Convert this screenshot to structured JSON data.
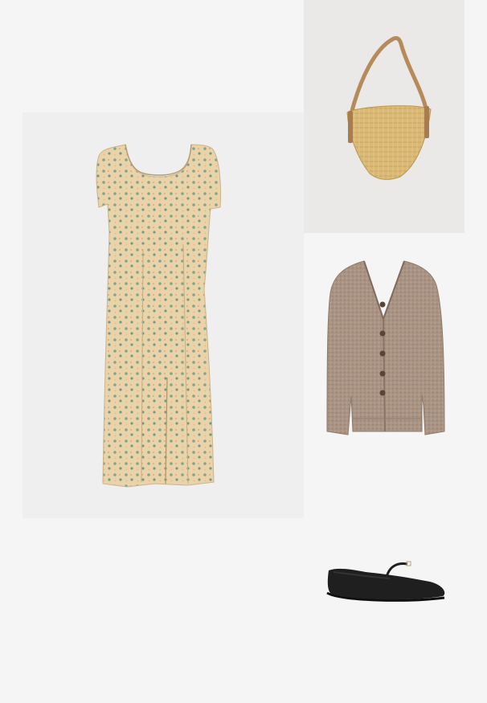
{
  "outfit": {
    "background_color": "#f5f5f5",
    "items": [
      {
        "name": "dress",
        "icon": "floral-midi-dress-icon",
        "colors": [
          "#e9d2a8",
          "#7fa58f"
        ]
      },
      {
        "name": "bag",
        "icon": "straw-shoulder-bag-icon",
        "colors": [
          "#d8b774",
          "#b7895a"
        ]
      },
      {
        "name": "cardigan",
        "icon": "knit-cardigan-icon",
        "colors": [
          "#a89282",
          "#5a4436"
        ]
      },
      {
        "name": "shoes",
        "icon": "black-mary-jane-flats-icon",
        "colors": [
          "#1f1f1f"
        ]
      }
    ]
  }
}
